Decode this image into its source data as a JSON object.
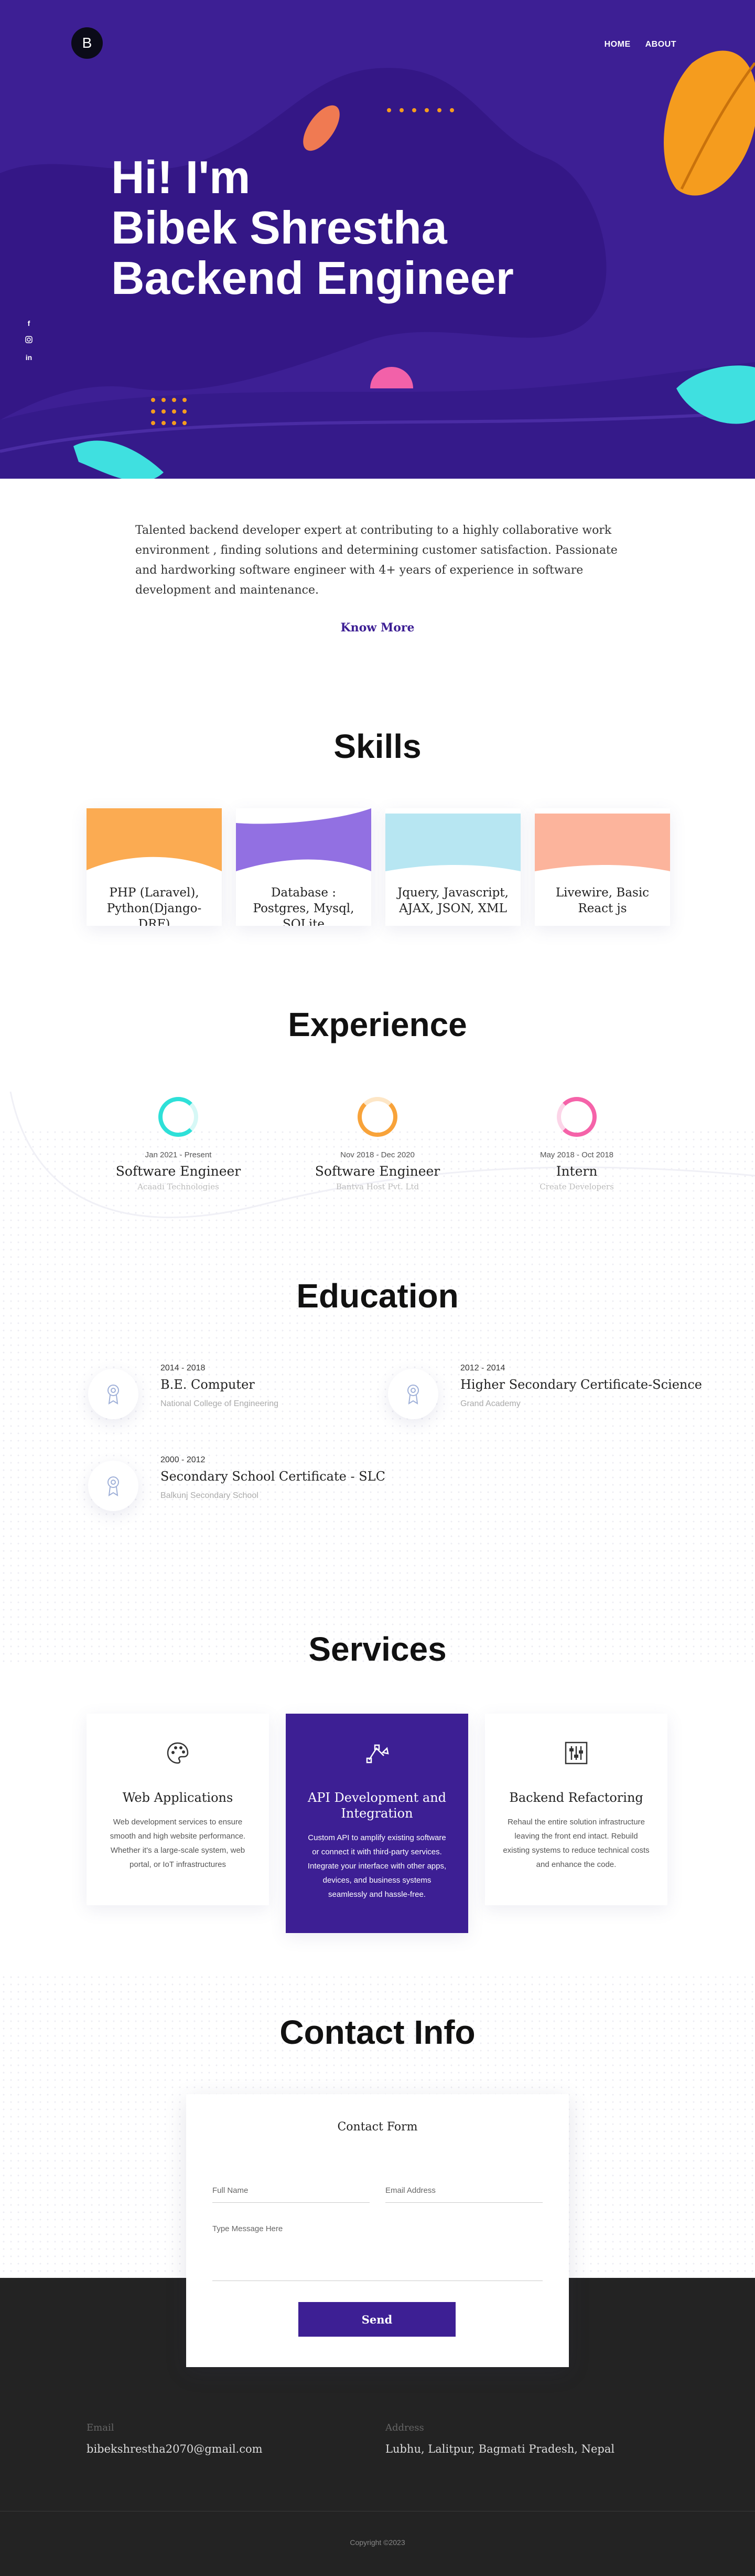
{
  "header": {
    "logo_letter": "B",
    "nav": [
      "HOME",
      "ABOUT"
    ],
    "social_icons": [
      "facebook-icon",
      "instagram-icon",
      "linkedin-icon"
    ]
  },
  "hero": {
    "line1": "Hi! I'm",
    "line2": "Bibek Shrestha",
    "line3": "Backend Engineer"
  },
  "about": {
    "text": "Talented backend developer expert at contributing to a highly collaborative work environment , finding solutions and determining customer satisfaction. Passionate and hardworking software engineer with 4+ years of experience in software development and maintenance.",
    "cta": "Know More"
  },
  "skills": {
    "title": "Skills",
    "items": [
      {
        "label": "PHP (Laravel), Python(Django-DRF)",
        "color": "#fbab52"
      },
      {
        "label": "Database : Postgres, Mysql, SQLite",
        "color": "#9270e2"
      },
      {
        "label": "Jquery, Javascript, AJAX, JSON, XML",
        "color": "#b7e6f2"
      },
      {
        "label": "Livewire, Basic React js",
        "color": "#fcb49c"
      }
    ]
  },
  "experience": {
    "title": "Experience",
    "items": [
      {
        "date": "Jan 2021 - Present",
        "role": "Software Engineer",
        "org": "Acaadi Technologies",
        "color": "#2ee0d8"
      },
      {
        "date": "Nov 2018 - Dec 2020",
        "role": "Software Engineer",
        "org": "Bantva Host Pvt. Ltd",
        "color": "#f8a33a"
      },
      {
        "date": "May 2018 - Oct 2018",
        "role": "Intern",
        "org": "Create Developers",
        "color": "#f563a9"
      }
    ]
  },
  "education": {
    "title": "Education",
    "items": [
      {
        "years": "2014 - 2018",
        "degree": "B.E. Computer",
        "school": "National College of Engineering"
      },
      {
        "years": "2012 - 2014",
        "degree": "Higher Secondary Certificate-Science",
        "school": "Grand Academy"
      },
      {
        "years": "2000 - 2012",
        "degree": "Secondary School Certificate - SLC",
        "school": "Balkunj Secondary School"
      }
    ]
  },
  "services": {
    "title": "Services",
    "items": [
      {
        "title": "Web Applications",
        "desc": "Web development services to ensure smooth and high website performance. Whether it's a large-scale system, web portal, or IoT infrastructures",
        "icon": "palette-icon"
      },
      {
        "title": "API Development and Integration",
        "desc": "Custom API to amplify existing software or connect it with third-party services. Integrate your interface with other apps, devices, and business systems seamlessly and hassle-free.",
        "icon": "vector-pen-icon"
      },
      {
        "title": "Backend Refactoring",
        "desc": "Rehaul the entire solution infrastructure leaving the front end intact. Rebuild existing systems to reduce technical costs and enhance the code.",
        "icon": "sliders-icon"
      }
    ]
  },
  "contact": {
    "title": "Contact Info",
    "form_title": "Contact Form",
    "full_name_placeholder": "Full Name",
    "email_placeholder": "Email Address",
    "message_placeholder": "Type Message Here",
    "send_label": "Send",
    "email_label": "Email",
    "email_value": "bibekshrestha2070@gmail.com",
    "address_label": "Address",
    "address_value": "Lubhu, Lalitpur, Bagmati Pradesh, Nepal",
    "copyright": "Copyright ©2023"
  },
  "colors": {
    "primary": "#3d1f94",
    "footer": "#232323"
  }
}
